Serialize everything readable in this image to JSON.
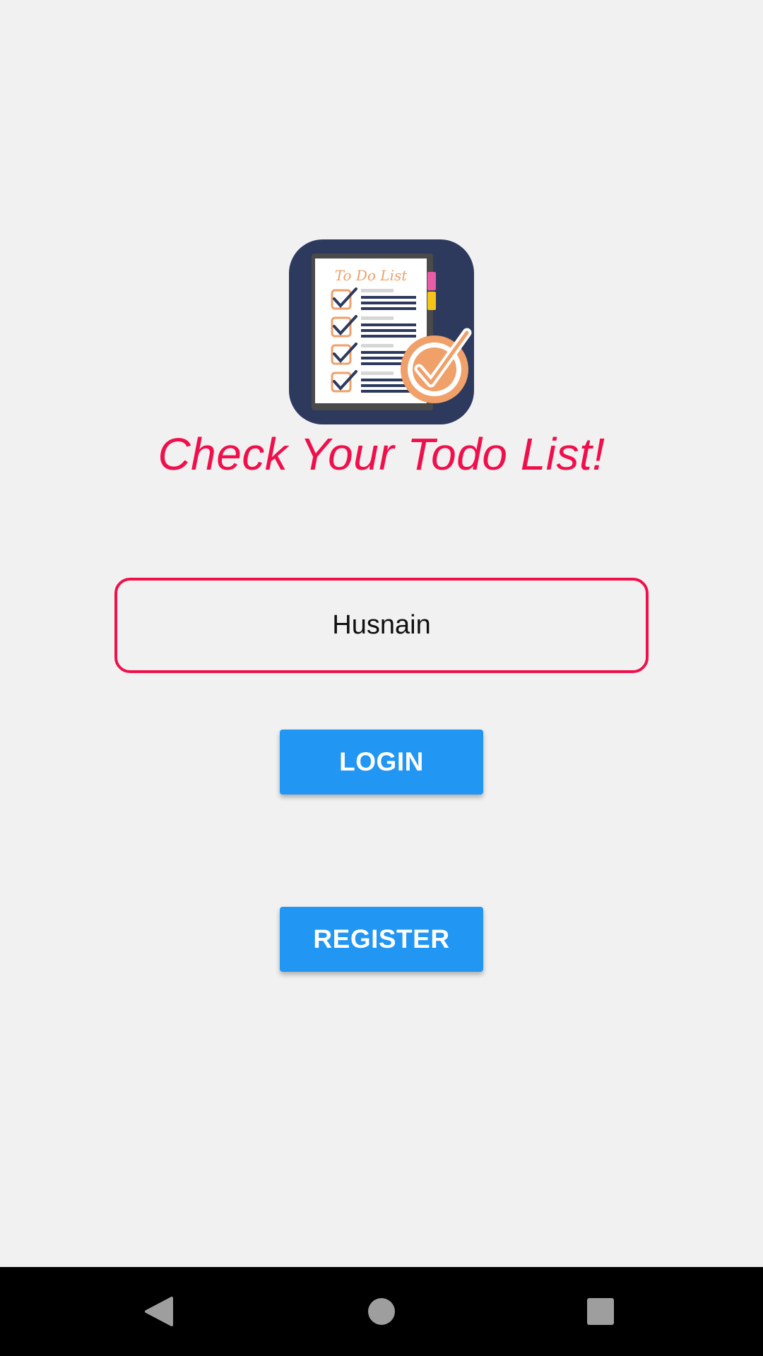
{
  "app": {
    "headline": "Check Your Todo List!",
    "logo_caption": "To Do List"
  },
  "login_form": {
    "name_value": "Husnain",
    "login_label": "LOGIN",
    "register_label": "REGISTER"
  },
  "nav_bar": {
    "back_icon": "triangle-back-icon",
    "home_icon": "circle-home-icon",
    "recents_icon": "square-recents-icon"
  },
  "colors": {
    "accent": "#f10f4b",
    "button": "#2196f3",
    "background": "#f2f1f2",
    "logo_background": "#2d3a5e",
    "logo_orange": "#f0a069"
  }
}
